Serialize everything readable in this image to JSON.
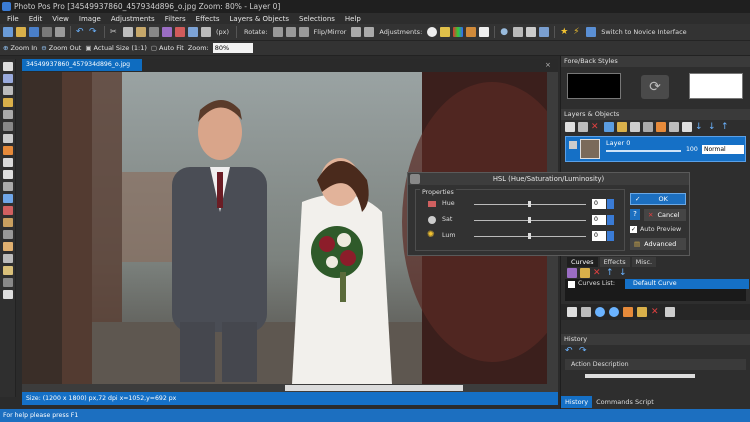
{
  "window": {
    "title": "Photo Pos Pro [34549937860_457934d896_o.jpg Zoom: 80% - Layer 0]"
  },
  "menu": [
    "File",
    "Edit",
    "View",
    "Image",
    "Adjustments",
    "Filters",
    "Effects",
    "Layers & Objects",
    "Selections",
    "Help"
  ],
  "toolbar": {
    "units": "(px)",
    "rotate_label": "Rotate:",
    "flip_label": "Flip/Mirror",
    "adjustments_label": "Adjustments:",
    "novice_label": "Switch to Novice Interface",
    "zoom_in": "Zoom In",
    "zoom_out": "Zoom Out",
    "actual_size": "Actual Size (1:1)",
    "auto_fit": "Auto Fit",
    "zoom_label": "Zoom:",
    "zoom_value": "80%"
  },
  "document": {
    "tab": "34549937860_457934d896_o.jpg",
    "close": "×",
    "status": "Size: (1200 x 1800) px,72 dpi    x=1052,y=692 px"
  },
  "statusbar": {
    "text": "For help please press F1"
  },
  "fore_back": {
    "title": "Fore/Back Styles"
  },
  "layers": {
    "title": "Layers & Objects",
    "layer_name": "Layer 0",
    "opacity": "100",
    "blend": "Normal"
  },
  "hsl": {
    "title": "HSL (Hue/Saturation/Luminosity)",
    "group": "Properties",
    "rows": [
      {
        "label": "Hue",
        "value": "0"
      },
      {
        "label": "Sat",
        "value": "0"
      },
      {
        "label": "Lum",
        "value": "0"
      }
    ],
    "ok": "OK",
    "cancel": "Cancel",
    "auto_preview": "Auto Preview",
    "advanced": "Advanced"
  },
  "curves": {
    "tabs": [
      "Curves",
      "Effects",
      "Misc."
    ],
    "list_label": "Curves List:",
    "default_item": "Default Curve"
  },
  "history": {
    "title": "History",
    "column": "Action Description",
    "tabs": [
      "History",
      "Commands Script"
    ]
  },
  "colors": {
    "accent": "#1570c6",
    "panel": "#2e2e2e"
  }
}
